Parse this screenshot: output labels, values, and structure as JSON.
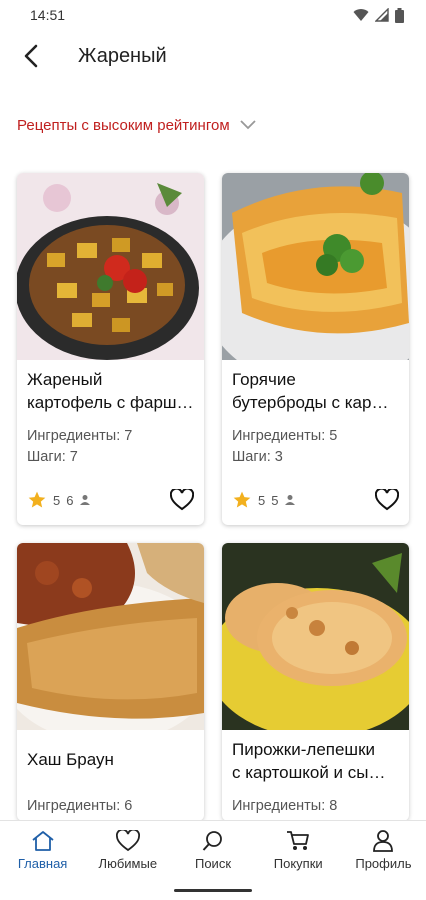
{
  "status_bar": {
    "time": "14:51"
  },
  "header": {
    "title": "Жареный"
  },
  "filter": {
    "label": "Рецепты с высоким рейтингом"
  },
  "recipes": [
    {
      "title_line1": "Жареный",
      "title_line2": "картофель с фарш…",
      "ingredients": "Ингредиенты: 7",
      "steps": "Шаги: 7",
      "rating": "5",
      "users": "6"
    },
    {
      "title_line1": "Горячие",
      "title_line2": "бутерброды с кар…",
      "ingredients": "Ингредиенты: 5",
      "steps": "Шаги: 3",
      "rating": "5",
      "users": "5"
    },
    {
      "title_line1": "Хаш Браун",
      "title_line2": "",
      "ingredients": "Ингредиенты: 6",
      "steps": "",
      "rating": "",
      "users": ""
    },
    {
      "title_line1": "Пирожки-лепешки",
      "title_line2": "с картошкой и сы…",
      "ingredients": "Ингредиенты: 8",
      "steps": "",
      "rating": "",
      "users": ""
    }
  ],
  "nav": {
    "home": "Главная",
    "favorites": "Любимые",
    "search": "Поиск",
    "shopping": "Покупки",
    "profile": "Профиль"
  },
  "colors": {
    "accent_red": "#c0201f",
    "nav_active": "#1f5fa8",
    "star": "#f2b01e"
  }
}
